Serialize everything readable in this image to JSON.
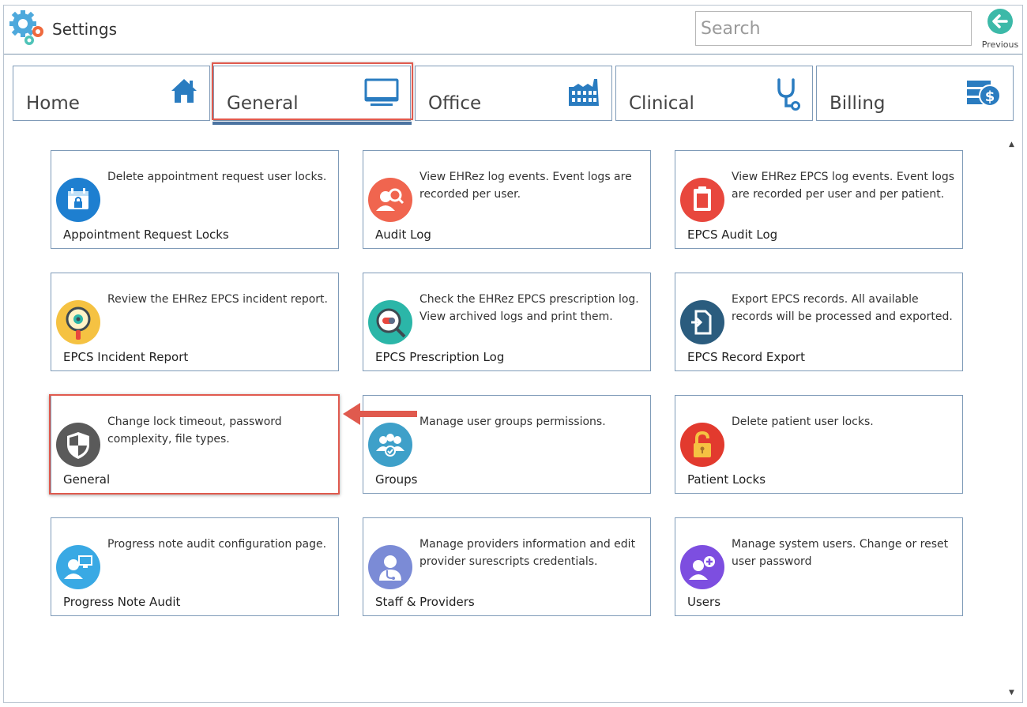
{
  "app": {
    "title": "Settings"
  },
  "search": {
    "placeholder": "Search"
  },
  "nav": {
    "previous_label": "Previous"
  },
  "tabs": [
    {
      "label": "Home",
      "icon": "home-icon"
    },
    {
      "label": "General",
      "icon": "monitor-icon",
      "selected": true
    },
    {
      "label": "Office",
      "icon": "factory-icon"
    },
    {
      "label": "Clinical",
      "icon": "stethoscope-icon"
    },
    {
      "label": "Billing",
      "icon": "billing-icon"
    }
  ],
  "cards": [
    {
      "title": "Appointment Request Locks",
      "description": "Delete appointment request user locks.",
      "icon": "calendar-lock-icon",
      "color": "#1e7fd0"
    },
    {
      "title": "Audit Log",
      "description": "View EHRez log events. Event logs are recorded per user.",
      "icon": "user-search-icon",
      "color": "#f0654f"
    },
    {
      "title": "EPCS Audit Log",
      "description": "View EHRez EPCS log events. Event logs are recorded per user and per patient.",
      "icon": "clipboard-icon",
      "color": "#e8473d"
    },
    {
      "title": "EPCS Incident Report",
      "description": "Review the EHRez EPCS incident report.",
      "icon": "magnifier-eye-icon",
      "color": "#f5c242"
    },
    {
      "title": "EPCS Prescription Log",
      "description": "Check the EHRez EPCS prescription log. View archived logs and print them.",
      "icon": "pill-search-icon",
      "color": "#2bb6a8"
    },
    {
      "title": "EPCS Record Export",
      "description": "Export EPCS records. All available records will be processed and exported.",
      "icon": "file-export-icon",
      "color": "#2b5c7e"
    },
    {
      "title": "General",
      "description": "Change lock timeout, password complexity, file types.",
      "icon": "shield-icon",
      "color": "#5a5a5a"
    },
    {
      "title": "Groups",
      "description": "Manage user groups permissions.",
      "icon": "user-group-icon",
      "color": "#3ea0c9"
    },
    {
      "title": "Patient Locks",
      "description": "Delete patient user locks.",
      "icon": "padlock-icon",
      "color": "#e23a2e"
    },
    {
      "title": "Progress Note Audit",
      "description": "Progress note audit configuration page.",
      "icon": "user-monitor-icon",
      "color": "#39a9e4"
    },
    {
      "title": "Staff & Providers",
      "description": "Manage providers information and edit provider surescripts credentials.",
      "icon": "doctor-icon",
      "color": "#7b8bd6"
    },
    {
      "title": "Users",
      "description": "Manage system users. Change or reset user password",
      "icon": "user-add-icon",
      "color": "#7d4ee0"
    }
  ],
  "colors": {
    "accent": "#4b73a1",
    "highlight": "#e05a4e",
    "border": "#7f9bb8",
    "tab_icon": "#2a7cc0"
  }
}
